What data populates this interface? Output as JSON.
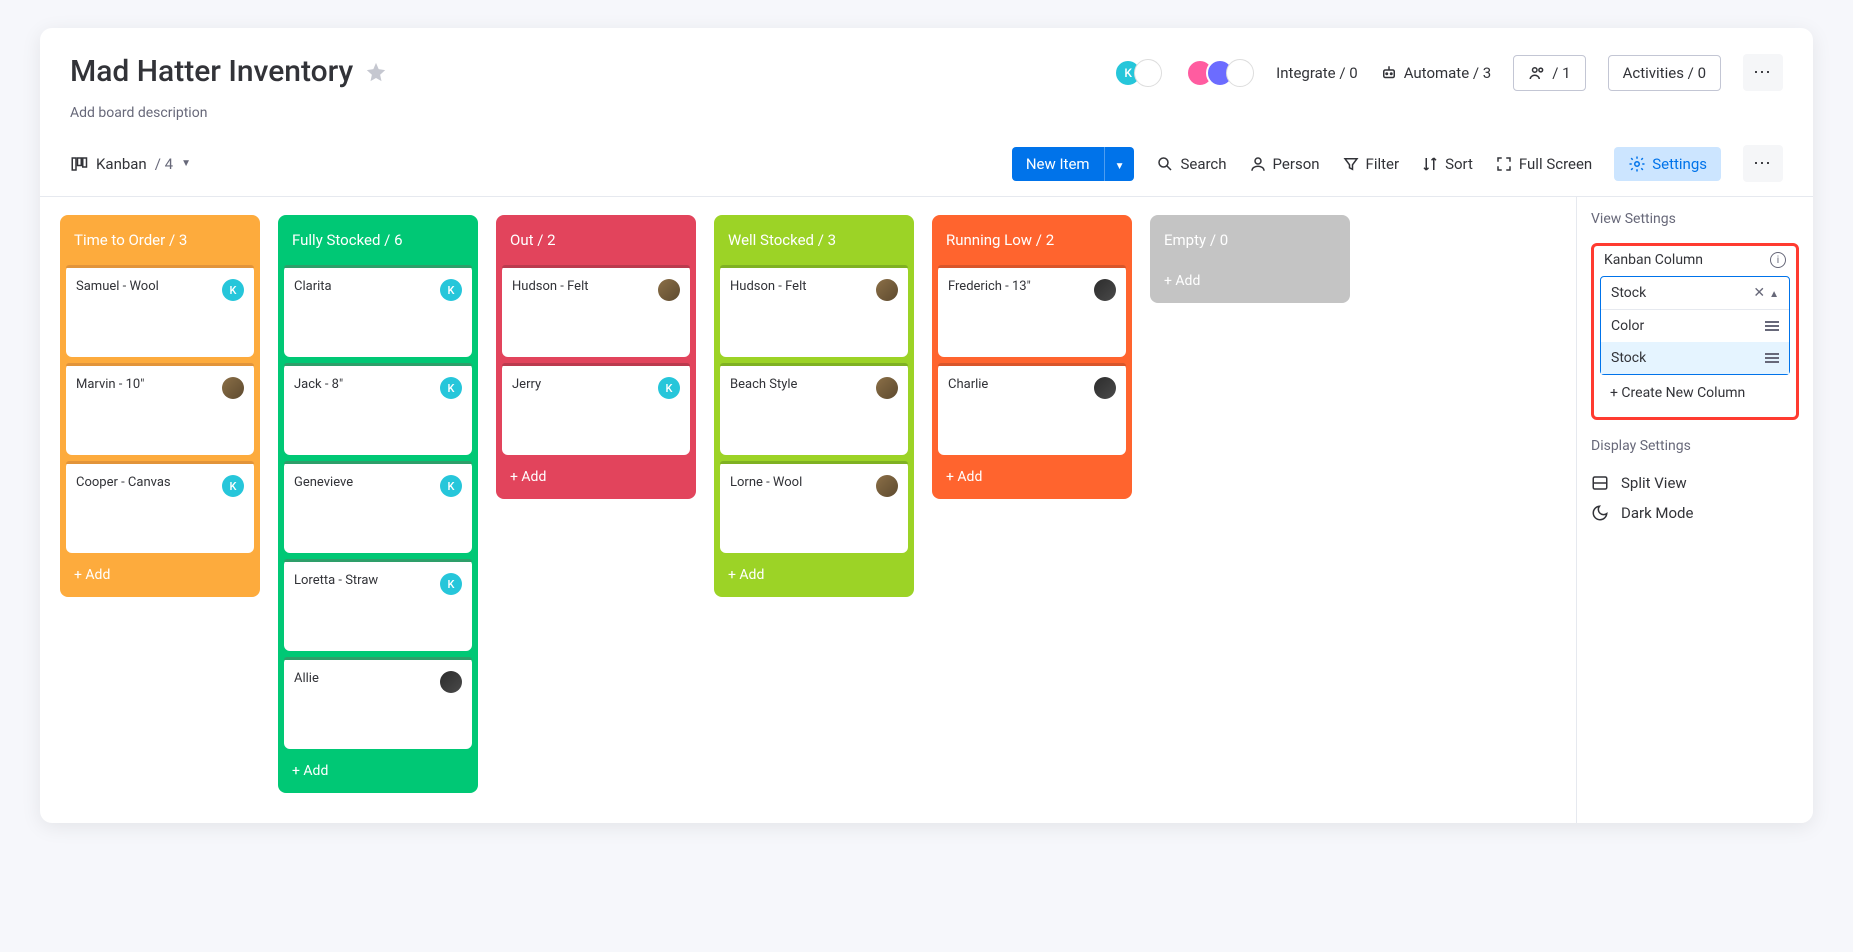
{
  "header": {
    "title": "Mad Hatter Inventory",
    "subtitle": "Add board description",
    "integrate": "Integrate / 0",
    "automate": "Automate / 3",
    "members": "/ 1",
    "activities": "Activities / 0"
  },
  "toolbar": {
    "view": "Kanban",
    "view_count": "/ 4",
    "new_item": "New Item",
    "search": "Search",
    "person": "Person",
    "filter": "Filter",
    "sort": "Sort",
    "fullscreen": "Full Screen",
    "settings": "Settings"
  },
  "columns": [
    {
      "title": "Time to Order / 3",
      "color": "#fdab3d",
      "accent": "#e2943a",
      "cards": [
        {
          "title": "Samuel - Wool",
          "avatar": "k"
        },
        {
          "title": "Marvin - 10\"",
          "avatar": "p1"
        },
        {
          "title": "Cooper - Canvas",
          "avatar": "k"
        }
      ],
      "add": "+ Add"
    },
    {
      "title": "Fully Stocked / 6",
      "color": "#00c875",
      "accent": "#2e9f6a",
      "cards": [
        {
          "title": "Clarita",
          "avatar": "k"
        },
        {
          "title": "Jack - 8\"",
          "avatar": "k"
        },
        {
          "title": "Genevieve",
          "avatar": "k"
        },
        {
          "title": "Loretta - Straw",
          "avatar": "k"
        },
        {
          "title": "Allie",
          "avatar": "p2"
        }
      ],
      "add": "+ Add"
    },
    {
      "title": "Out / 2",
      "color": "#e2445c",
      "accent": "#bb3a4e",
      "cards": [
        {
          "title": "Hudson - Felt",
          "avatar": "p1"
        },
        {
          "title": "Jerry",
          "avatar": "k"
        }
      ],
      "add": "+ Add"
    },
    {
      "title": "Well Stocked / 3",
      "color": "#9cd326",
      "accent": "#7fb122",
      "cards": [
        {
          "title": "Hudson - Felt",
          "avatar": "p1"
        },
        {
          "title": "Beach Style",
          "avatar": "p1"
        },
        {
          "title": "Lorne - Wool",
          "avatar": "p1"
        }
      ],
      "add": "+ Add"
    },
    {
      "title": "Running Low / 2",
      "color": "#ff642e",
      "accent": "#d9552a",
      "cards": [
        {
          "title": "Frederich - 13\"",
          "avatar": "p2"
        },
        {
          "title": "Charlie",
          "avatar": "p2"
        }
      ],
      "add": "+ Add"
    },
    {
      "title": "Empty / 0",
      "color": "#c4c4c4",
      "accent": "#a0a0a0",
      "cards": [],
      "add": "+ Add"
    }
  ],
  "panel": {
    "view_settings": "View Settings",
    "kanban_col": "Kanban Column",
    "selected": "Stock",
    "opt_color": "Color",
    "opt_stock": "Stock",
    "create_new": "+ Create New Column",
    "display_settings": "Display Settings",
    "split_view": "Split View",
    "dark_mode": "Dark Mode"
  }
}
